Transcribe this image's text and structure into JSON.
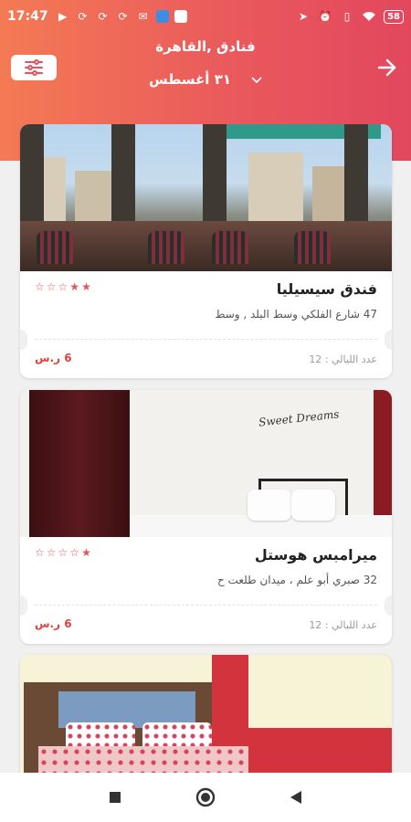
{
  "status_bar": {
    "time": "17:47",
    "battery": "58",
    "icons_left": [
      "media-icon",
      "sync-icon",
      "sync-icon",
      "sync-icon",
      "mail-icon",
      "app-icon",
      "app-icon"
    ],
    "icons_right": [
      "location-icon",
      "alarm-icon",
      "vibrate-icon",
      "wifi-icon"
    ]
  },
  "header": {
    "title": "فنادق ,القاهرة",
    "date": "٣١ أغسطس",
    "colors": {
      "gradient_start": "#f47a54",
      "gradient_end": "#e2475e"
    }
  },
  "hotels": [
    {
      "name": "فندق سيسيليا",
      "address": "47 شارع الفلكي وسط البلد , وسط",
      "stars_filled": 2,
      "stars_total": 5,
      "nights_label": "عدد الليالي :",
      "nights": "12",
      "price": "6 ر.س"
    },
    {
      "name": "ميرامبس هوستل",
      "address": "32 صبري أبو علم ، ميدان طلعت ح",
      "stars_filled": 1,
      "stars_total": 5,
      "nights_label": "عدد الليالي :",
      "nights": "12",
      "price": "6 ر.س"
    }
  ],
  "photo_text": {
    "sweet_dreams": "Sweet Dreams"
  },
  "accent_color": "#e0413a"
}
